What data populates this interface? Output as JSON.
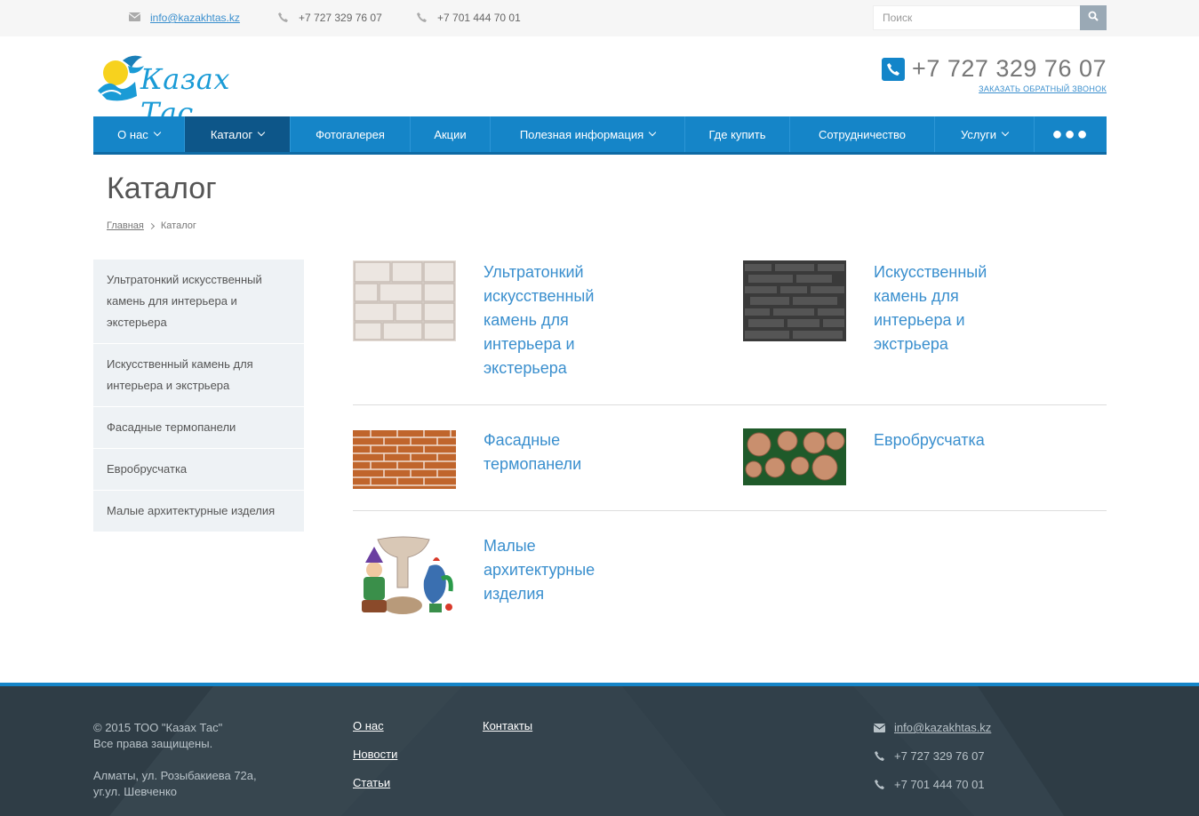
{
  "topbar": {
    "email": "info@kazakhtas.kz",
    "phone1": "+7 727 329 76 07",
    "phone2": "+7 701 444 70 01",
    "search_placeholder": "Поиск"
  },
  "header": {
    "logo_text": "Казах Тас",
    "phone": "+7 727 329 76 07",
    "callback": "ЗАКАЗАТЬ ОБРАТНЫЙ ЗВОНОК"
  },
  "nav": {
    "items": [
      {
        "label": "О нас"
      },
      {
        "label": "Каталог"
      },
      {
        "label": "Фотогалерея"
      },
      {
        "label": "Акции"
      },
      {
        "label": "Полезная информация"
      },
      {
        "label": "Где купить"
      },
      {
        "label": "Сотрудничество"
      },
      {
        "label": "Услуги"
      },
      {
        "label": "●●●"
      }
    ]
  },
  "page": {
    "title": "Каталог",
    "breadcrumb_home": "Главная",
    "breadcrumb_current": "Каталог"
  },
  "sidebar": {
    "items": [
      {
        "label": "Ультратонкий искусственный камень для интерьера и экстерьера"
      },
      {
        "label": "Искусственный камень для интерьера и экстрьера"
      },
      {
        "label": "Фасадные термопанели"
      },
      {
        "label": "Евробрусчатка"
      },
      {
        "label": "Малые архитектурные изделия"
      }
    ]
  },
  "catalog": {
    "items": [
      {
        "label": "Ультратонкий искусственный камень для интерьера и экстерьера",
        "image": "light-stone-image"
      },
      {
        "label": "Искусственный камень для интерьера и экстрьера",
        "image": "dark-stone-image"
      },
      {
        "label": "Фасадные термопанели",
        "image": "brick-panel-image"
      },
      {
        "label": "Евробрусчатка",
        "image": "paving-stones-image"
      },
      {
        "label": "Малые архитектурные изделия",
        "image": "garden-figures-image"
      }
    ]
  },
  "footer": {
    "copyright": "© 2015 ТОО \"Казах Тас\"",
    "rights": "Все права защищены.",
    "address1": "Алматы, ул. Розыбакиева 72а,",
    "address2": "уг.ул. Шевченко",
    "links": [
      {
        "label": "О нас"
      },
      {
        "label": "Новости"
      },
      {
        "label": "Статьи"
      },
      {
        "label": "Контакты"
      }
    ],
    "email": "info@kazakhtas.kz",
    "phone1": "+7 727 329 76 07",
    "phone2": "+7 701 444 70 01"
  },
  "colors": {
    "accent": "#1585c8",
    "nav_active": "#0d5689",
    "link": "#3a8fce",
    "footer_bg": "#34434d"
  }
}
